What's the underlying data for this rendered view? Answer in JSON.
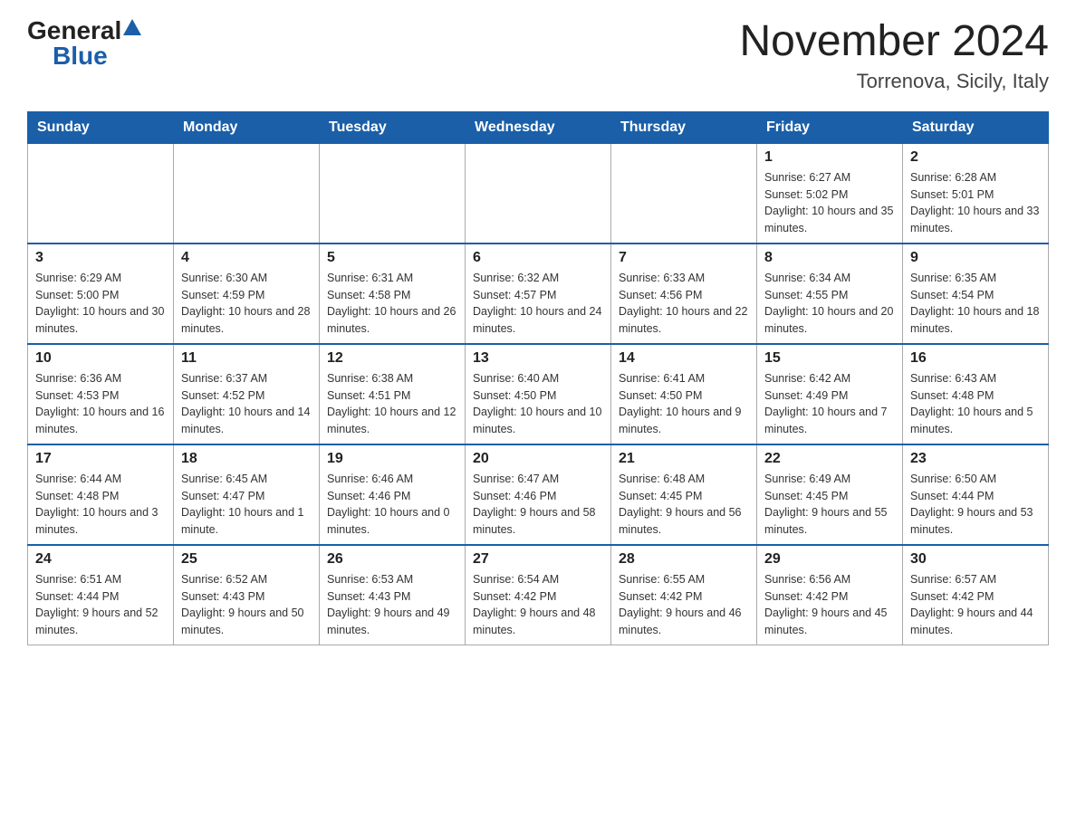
{
  "header": {
    "logo_general": "General",
    "logo_blue": "Blue",
    "month_title": "November 2024",
    "location": "Torrenova, Sicily, Italy"
  },
  "days_of_week": [
    "Sunday",
    "Monday",
    "Tuesday",
    "Wednesday",
    "Thursday",
    "Friday",
    "Saturday"
  ],
  "weeks": [
    [
      {
        "day": "",
        "info": ""
      },
      {
        "day": "",
        "info": ""
      },
      {
        "day": "",
        "info": ""
      },
      {
        "day": "",
        "info": ""
      },
      {
        "day": "",
        "info": ""
      },
      {
        "day": "1",
        "info": "Sunrise: 6:27 AM\nSunset: 5:02 PM\nDaylight: 10 hours and 35 minutes."
      },
      {
        "day": "2",
        "info": "Sunrise: 6:28 AM\nSunset: 5:01 PM\nDaylight: 10 hours and 33 minutes."
      }
    ],
    [
      {
        "day": "3",
        "info": "Sunrise: 6:29 AM\nSunset: 5:00 PM\nDaylight: 10 hours and 30 minutes."
      },
      {
        "day": "4",
        "info": "Sunrise: 6:30 AM\nSunset: 4:59 PM\nDaylight: 10 hours and 28 minutes."
      },
      {
        "day": "5",
        "info": "Sunrise: 6:31 AM\nSunset: 4:58 PM\nDaylight: 10 hours and 26 minutes."
      },
      {
        "day": "6",
        "info": "Sunrise: 6:32 AM\nSunset: 4:57 PM\nDaylight: 10 hours and 24 minutes."
      },
      {
        "day": "7",
        "info": "Sunrise: 6:33 AM\nSunset: 4:56 PM\nDaylight: 10 hours and 22 minutes."
      },
      {
        "day": "8",
        "info": "Sunrise: 6:34 AM\nSunset: 4:55 PM\nDaylight: 10 hours and 20 minutes."
      },
      {
        "day": "9",
        "info": "Sunrise: 6:35 AM\nSunset: 4:54 PM\nDaylight: 10 hours and 18 minutes."
      }
    ],
    [
      {
        "day": "10",
        "info": "Sunrise: 6:36 AM\nSunset: 4:53 PM\nDaylight: 10 hours and 16 minutes."
      },
      {
        "day": "11",
        "info": "Sunrise: 6:37 AM\nSunset: 4:52 PM\nDaylight: 10 hours and 14 minutes."
      },
      {
        "day": "12",
        "info": "Sunrise: 6:38 AM\nSunset: 4:51 PM\nDaylight: 10 hours and 12 minutes."
      },
      {
        "day": "13",
        "info": "Sunrise: 6:40 AM\nSunset: 4:50 PM\nDaylight: 10 hours and 10 minutes."
      },
      {
        "day": "14",
        "info": "Sunrise: 6:41 AM\nSunset: 4:50 PM\nDaylight: 10 hours and 9 minutes."
      },
      {
        "day": "15",
        "info": "Sunrise: 6:42 AM\nSunset: 4:49 PM\nDaylight: 10 hours and 7 minutes."
      },
      {
        "day": "16",
        "info": "Sunrise: 6:43 AM\nSunset: 4:48 PM\nDaylight: 10 hours and 5 minutes."
      }
    ],
    [
      {
        "day": "17",
        "info": "Sunrise: 6:44 AM\nSunset: 4:48 PM\nDaylight: 10 hours and 3 minutes."
      },
      {
        "day": "18",
        "info": "Sunrise: 6:45 AM\nSunset: 4:47 PM\nDaylight: 10 hours and 1 minute."
      },
      {
        "day": "19",
        "info": "Sunrise: 6:46 AM\nSunset: 4:46 PM\nDaylight: 10 hours and 0 minutes."
      },
      {
        "day": "20",
        "info": "Sunrise: 6:47 AM\nSunset: 4:46 PM\nDaylight: 9 hours and 58 minutes."
      },
      {
        "day": "21",
        "info": "Sunrise: 6:48 AM\nSunset: 4:45 PM\nDaylight: 9 hours and 56 minutes."
      },
      {
        "day": "22",
        "info": "Sunrise: 6:49 AM\nSunset: 4:45 PM\nDaylight: 9 hours and 55 minutes."
      },
      {
        "day": "23",
        "info": "Sunrise: 6:50 AM\nSunset: 4:44 PM\nDaylight: 9 hours and 53 minutes."
      }
    ],
    [
      {
        "day": "24",
        "info": "Sunrise: 6:51 AM\nSunset: 4:44 PM\nDaylight: 9 hours and 52 minutes."
      },
      {
        "day": "25",
        "info": "Sunrise: 6:52 AM\nSunset: 4:43 PM\nDaylight: 9 hours and 50 minutes."
      },
      {
        "day": "26",
        "info": "Sunrise: 6:53 AM\nSunset: 4:43 PM\nDaylight: 9 hours and 49 minutes."
      },
      {
        "day": "27",
        "info": "Sunrise: 6:54 AM\nSunset: 4:42 PM\nDaylight: 9 hours and 48 minutes."
      },
      {
        "day": "28",
        "info": "Sunrise: 6:55 AM\nSunset: 4:42 PM\nDaylight: 9 hours and 46 minutes."
      },
      {
        "day": "29",
        "info": "Sunrise: 6:56 AM\nSunset: 4:42 PM\nDaylight: 9 hours and 45 minutes."
      },
      {
        "day": "30",
        "info": "Sunrise: 6:57 AM\nSunset: 4:42 PM\nDaylight: 9 hours and 44 minutes."
      }
    ]
  ]
}
